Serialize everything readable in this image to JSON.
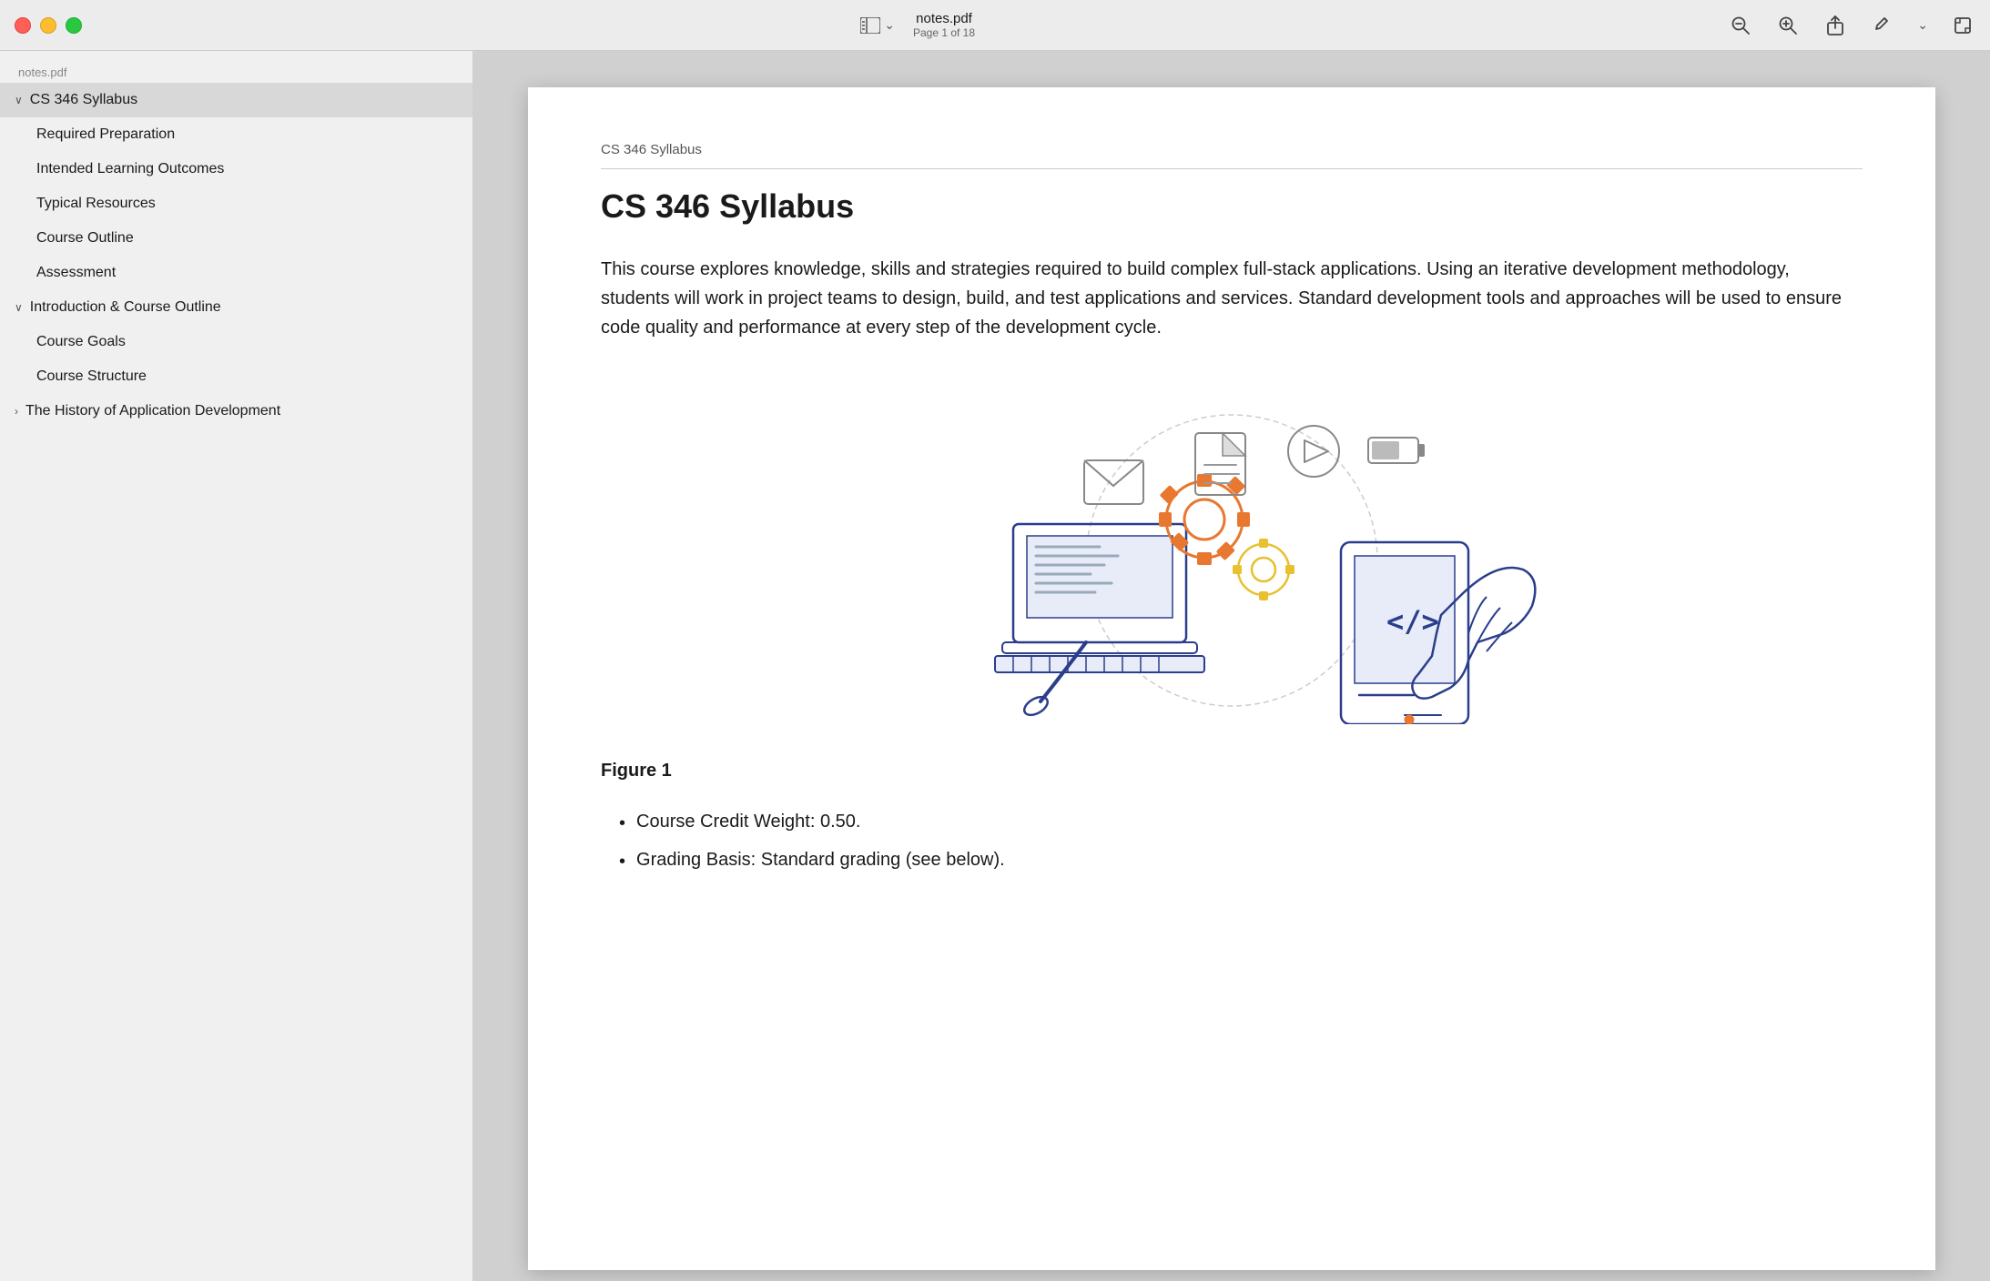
{
  "window": {
    "title": "notes.pdf",
    "filename": "notes.pdf",
    "page_info": "Page 1 of 18"
  },
  "titlebar": {
    "sidebar_toggle_label": "⊞",
    "chevron_label": "⌄"
  },
  "toolbar": {
    "search_zoom_out": "🔍",
    "search_zoom_in": "🔍",
    "share": "⬆",
    "pencil": "✏",
    "chevron": "⌄",
    "crop": "⊡"
  },
  "sidebar": {
    "filename": "notes.pdf",
    "items": [
      {
        "id": "cs346-syllabus",
        "label": "CS 346 Syllabus",
        "level": "top",
        "expanded": true,
        "active": true,
        "chevron": "∨"
      },
      {
        "id": "required-preparation",
        "label": "Required Preparation",
        "level": "level1"
      },
      {
        "id": "intended-learning-outcomes",
        "label": "Intended Learning Outcomes",
        "level": "level1"
      },
      {
        "id": "typical-resources",
        "label": "Typical Resources",
        "level": "level1"
      },
      {
        "id": "course-outline",
        "label": "Course Outline",
        "level": "level1"
      },
      {
        "id": "assessment",
        "label": "Assessment",
        "level": "level1"
      },
      {
        "id": "intro-course-outline",
        "label": "Introduction & Course Outline",
        "level": "top",
        "expanded": true,
        "chevron": "∨"
      },
      {
        "id": "course-goals",
        "label": "Course Goals",
        "level": "level1"
      },
      {
        "id": "course-structure",
        "label": "Course Structure",
        "level": "level1"
      },
      {
        "id": "history-app-dev",
        "label": "The History of Application Development",
        "level": "top",
        "expanded": false,
        "chevron": "›"
      }
    ]
  },
  "pdf": {
    "breadcrumb": "CS 346 Syllabus",
    "main_title": "CS 346 Syllabus",
    "body_text": "This course explores knowledge, skills and strategies required to build complex full-s... Using an iterative development methodology, students will work in project teams t... and test applications and services.  Standard development tools and approaches v... sure code quality and performance at every step of the development cycle.",
    "body_paragraphs": [
      "This course explores knowledge, skills and strategies required to build complex full-stack applications. Using an iterative development methodology, students will work in project teams to design, build, and test applications and services.  Standard development tools and approaches will be used to ensure code quality and performance at every step of the development cycle."
    ],
    "figure_caption": "Figure 1",
    "list_items": [
      "Course Credit Weight: 0.50.",
      "Grading Basis: Standard grading (see below)."
    ]
  }
}
